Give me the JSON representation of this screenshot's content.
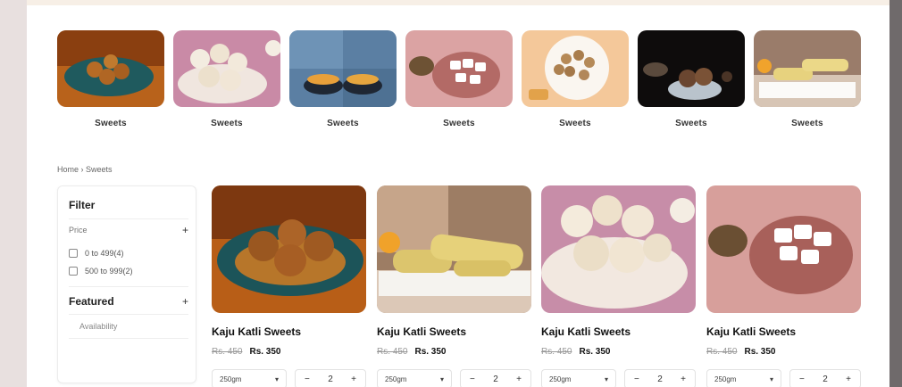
{
  "categories": [
    {
      "label": "Sweets"
    },
    {
      "label": "Sweets"
    },
    {
      "label": "Sweets"
    },
    {
      "label": "Sweets"
    },
    {
      "label": "Sweets"
    },
    {
      "label": "Sweets"
    },
    {
      "label": "Sweets"
    }
  ],
  "breadcrumb": "Home › Sweets",
  "filter": {
    "title": "Filter",
    "price_label": "Price",
    "options": [
      "0 to 499(4)",
      "500 to 999(2)"
    ],
    "featured_label": "Featured",
    "availability_label": "Availability",
    "plus": "+"
  },
  "products": [
    {
      "name": "Kaju Katli Sweets",
      "old_price": "Rs. 450",
      "price": "Rs. 350",
      "weight": "250gm",
      "qty": "2"
    },
    {
      "name": "Kaju Katli Sweets",
      "old_price": "Rs. 450",
      "price": "Rs. 350",
      "weight": "250gm",
      "qty": "2"
    },
    {
      "name": "Kaju Katli Sweets",
      "old_price": "Rs. 450",
      "price": "Rs. 350",
      "weight": "250gm",
      "qty": "2"
    },
    {
      "name": "Kaju Katli Sweets",
      "old_price": "Rs. 450",
      "price": "Rs. 350",
      "weight": "250gm",
      "qty": "2"
    }
  ],
  "stepper": {
    "minus": "−",
    "plus": "+"
  },
  "icons": {
    "dropdown": "chevron-down-icon"
  }
}
